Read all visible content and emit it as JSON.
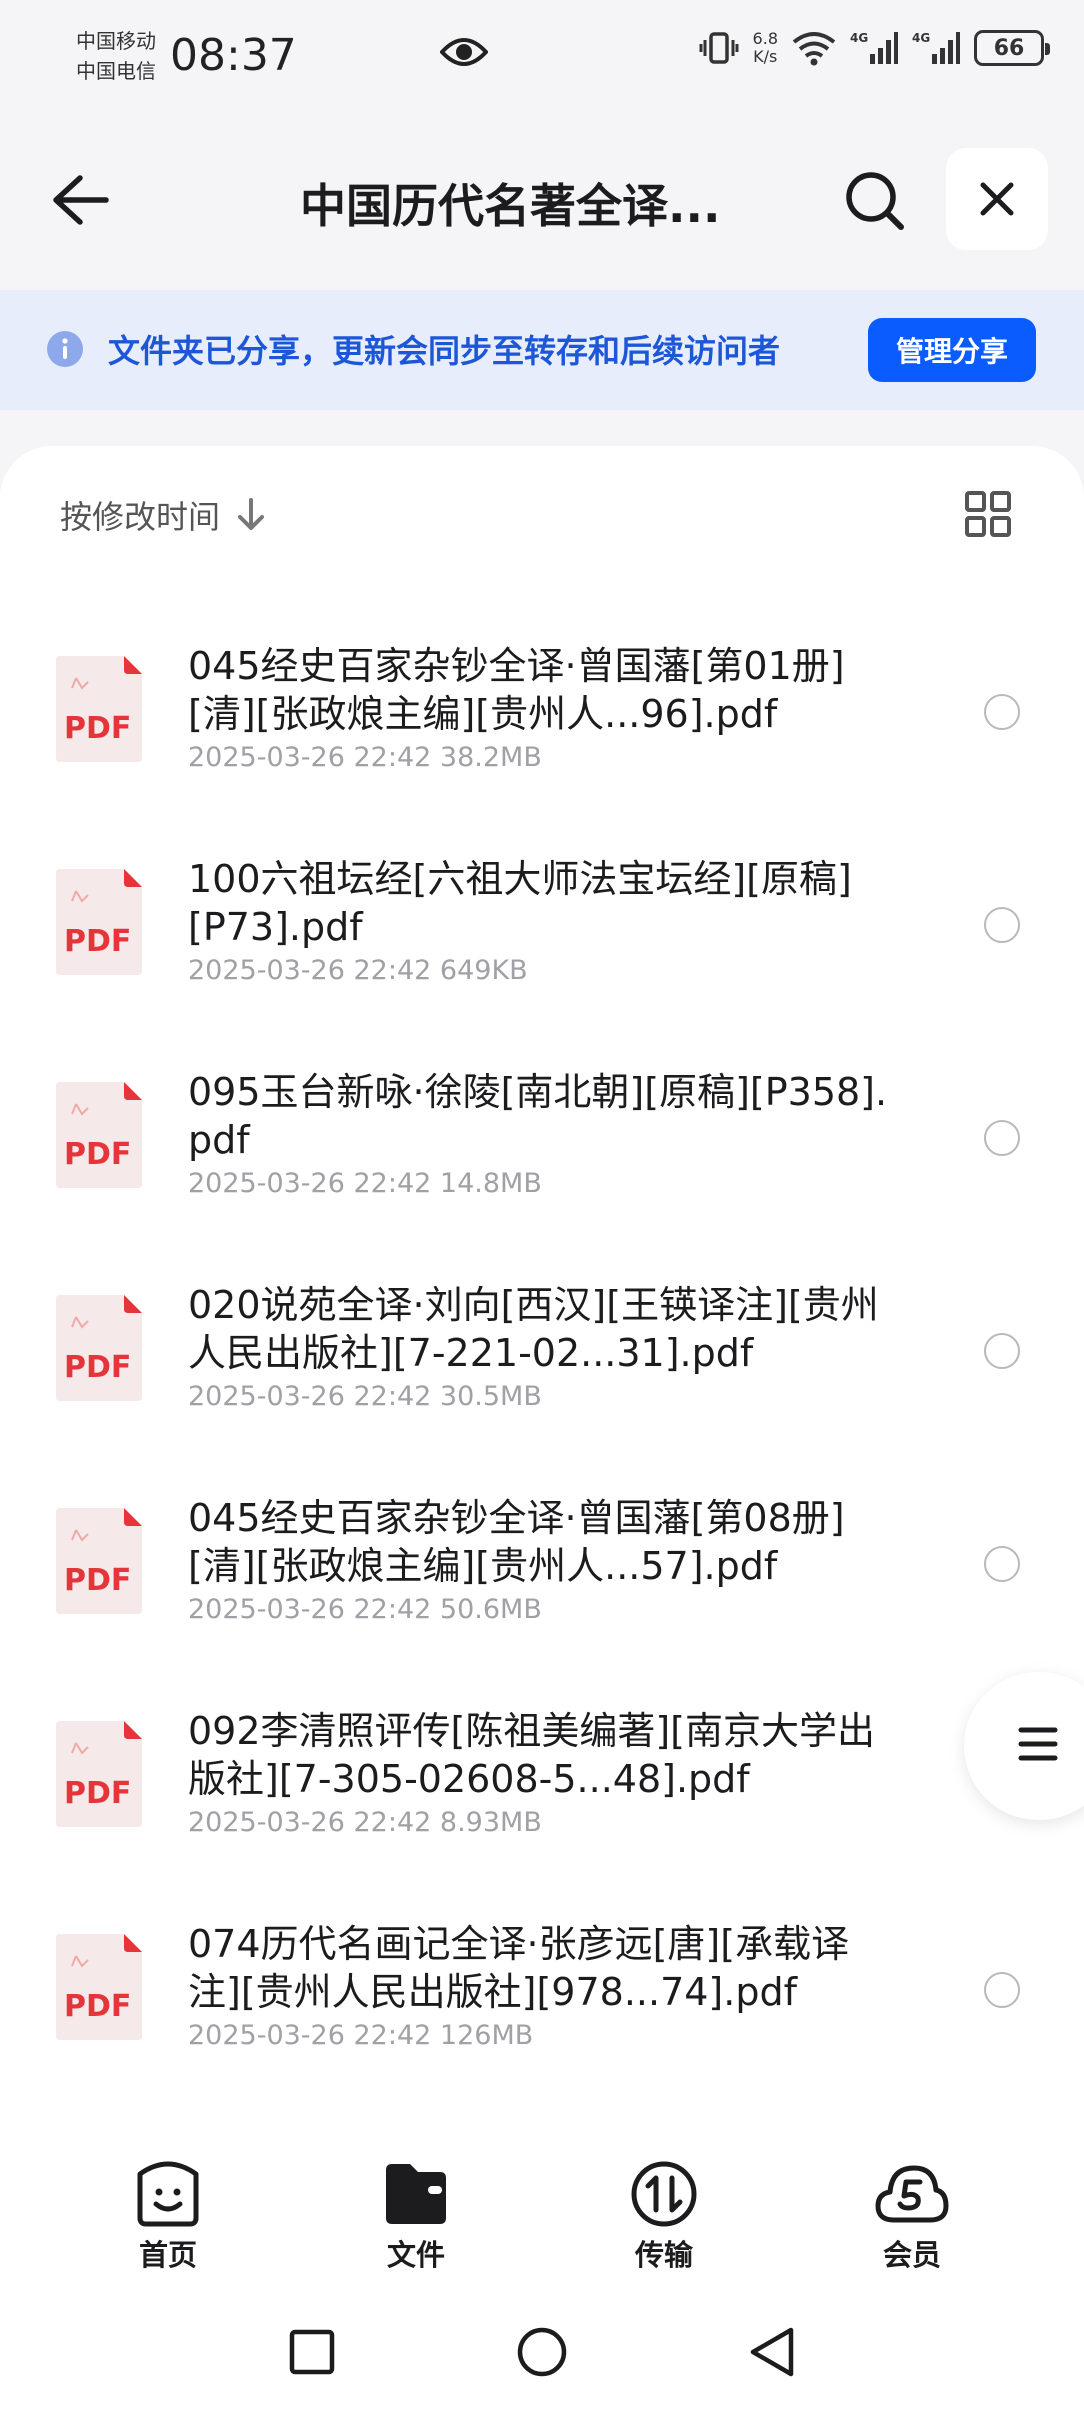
{
  "status_bar": {
    "carrier_1": "中国移动",
    "carrier_2": "中国电信",
    "time": "08:37",
    "net_speed_value": "6.8",
    "net_speed_unit": "K/s",
    "battery": "66",
    "icons": [
      "eye-icon",
      "vibrate-icon",
      "wifi-icon",
      "signal-4g-icon",
      "signal-4g-icon",
      "battery-icon"
    ]
  },
  "header": {
    "title": "中国历代名著全译...",
    "icons": [
      "back-arrow-icon",
      "search-icon",
      "close-icon"
    ]
  },
  "share_banner": {
    "text": "文件夹已分享，更新会同步至转存和后续访问者",
    "button_label": "管理分享",
    "icon": "info-icon"
  },
  "sort": {
    "label": "按修改时间",
    "icon": "arrow-down-icon",
    "view_icon": "grid-view-icon"
  },
  "files": [
    {
      "name": "045经史百家杂钞全译·曾国藩[第01册][清][张政烺主编][贵州人...96].pdf",
      "date": "2025-03-26 22:42",
      "size": "38.2MB",
      "type_label": "PDF"
    },
    {
      "name": "100六祖坛经[六祖大师法宝坛经][原稿][P73].pdf",
      "date": "2025-03-26 22:42",
      "size": "649KB",
      "type_label": "PDF"
    },
    {
      "name": "095玉台新咏·徐陵[南北朝][原稿][P358].pdf",
      "date": "2025-03-26 22:42",
      "size": "14.8MB",
      "type_label": "PDF"
    },
    {
      "name": "020说苑全译·刘向[西汉][王锳译注][贵州人民出版社][7-221-02...31].pdf",
      "date": "2025-03-26 22:42",
      "size": "30.5MB",
      "type_label": "PDF"
    },
    {
      "name": "045经史百家杂钞全译·曾国藩[第08册][清][张政烺主编][贵州人...57].pdf",
      "date": "2025-03-26 22:42",
      "size": "50.6MB",
      "type_label": "PDF"
    },
    {
      "name": "092李清照评传[陈祖美编著][南京大学出版社][7-305-02608-5...48].pdf",
      "date": "2025-03-26 22:42",
      "size": "8.93MB",
      "type_label": "PDF"
    },
    {
      "name": "074历代名画记全译·张彦远[唐][承载译注][贵州人民出版社][978...74].pdf",
      "date": "2025-03-26 22:42",
      "size": "126MB",
      "type_label": "PDF"
    }
  ],
  "float_menu": {
    "icon": "menu-icon"
  },
  "bottom_nav": [
    {
      "label": "首页",
      "icon": "home-face-icon"
    },
    {
      "label": "文件",
      "icon": "folder-icon"
    },
    {
      "label": "传输",
      "icon": "transfer-icon"
    },
    {
      "label": "会员",
      "icon": "cloud-vip-icon"
    }
  ],
  "system_nav": {
    "icons": [
      "recent-apps-icon",
      "home-icon",
      "back-icon"
    ]
  },
  "colors": {
    "accent": "#0b5cff",
    "banner_bg": "#e8edfb",
    "banner_text": "#1d57d8",
    "pdf_red": "#e5353a"
  }
}
